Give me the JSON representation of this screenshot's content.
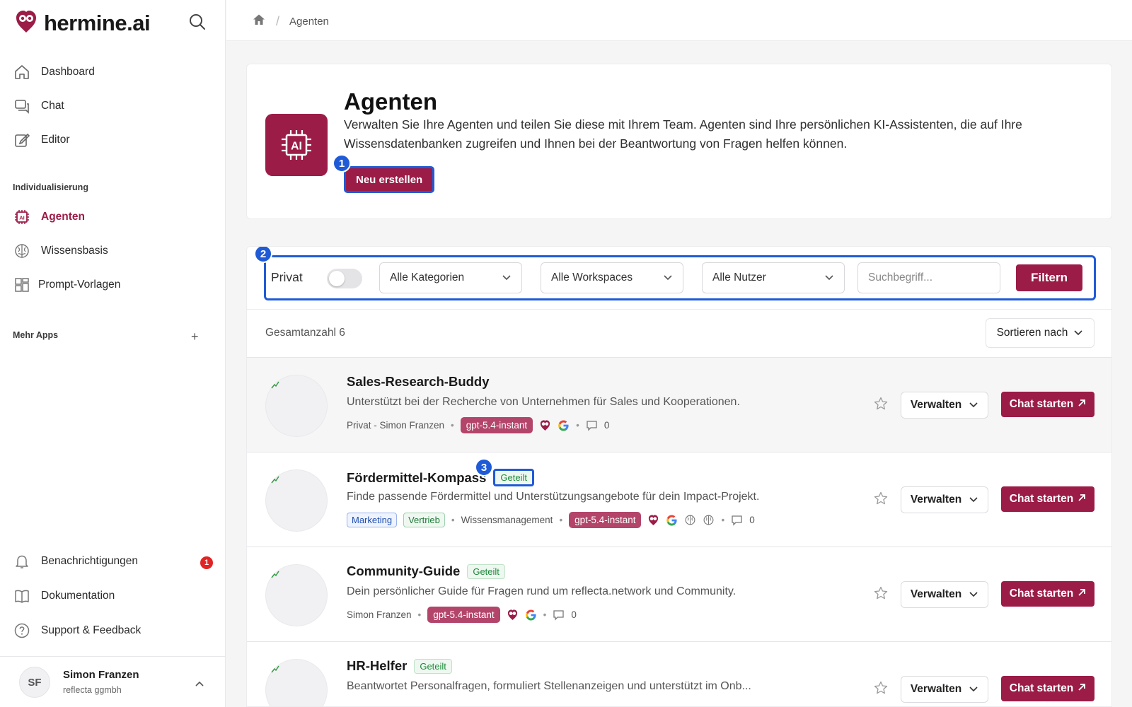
{
  "app": {
    "logo_text": "hermine.ai"
  },
  "sidebar": {
    "main_items": [
      {
        "label": "Dashboard",
        "icon": "home-icon"
      },
      {
        "label": "Chat",
        "icon": "chat-icon"
      },
      {
        "label": "Editor",
        "icon": "edit-icon"
      }
    ],
    "section_custom": "Individualisierung",
    "custom_items": [
      {
        "label": "Agenten",
        "icon": "ai-chip-icon",
        "active": true
      },
      {
        "label": "Wissensbasis",
        "icon": "brain-icon"
      },
      {
        "label": "Prompt-Vorlagen",
        "icon": "template-icon"
      }
    ],
    "section_more": "Mehr Apps",
    "bottom_items": [
      {
        "label": "Benachrichtigungen",
        "icon": "bell-icon",
        "badge": "1"
      },
      {
        "label": "Dokumentation",
        "icon": "book-icon"
      },
      {
        "label": "Support & Feedback",
        "icon": "help-icon"
      }
    ],
    "user": {
      "initials": "SF",
      "name": "Simon Franzen",
      "org": "reflecta ggmbh"
    }
  },
  "breadcrumb": {
    "current": "Agenten"
  },
  "hero": {
    "title": "Agenten",
    "description": "Verwalten Sie Ihre Agenten und teilen Sie diese mit Ihrem Team. Agenten sind Ihre persönlichen KI-Assistenten, die auf Ihre Wissensdatenbanken zugreifen und Ihnen bei der Beantwortung von Fragen helfen können.",
    "new_button": "Neu erstellen"
  },
  "markers": {
    "m1": "1",
    "m2": "2",
    "m3": "3"
  },
  "filters": {
    "privat_label": "Privat",
    "privat_on": false,
    "categories": "Alle Kategorien",
    "workspaces": "Alle Workspaces",
    "users": "Alle Nutzer",
    "search_placeholder": "Suchbegriff...",
    "filter_button": "Filtern"
  },
  "summary": {
    "total": "Gesamtanzahl 6",
    "sort_label": "Sortieren nach"
  },
  "agents": [
    {
      "name": "Sales-Research-Buddy",
      "shared": "",
      "description": "Unterstützt bei der Recherche von Unternehmen für Sales und Kooperationen.",
      "owner": "Privat - Simon Franzen",
      "model": "gpt-5.4-instant",
      "comments": "0",
      "manage": "Verwalten",
      "chat": "Chat starten"
    },
    {
      "name": "Fördermittel-Kompass",
      "shared": "Geteilt",
      "description": "Finde passende Fördermittel und Unterstützungsangebote für dein Impact-Projekt.",
      "tags": [
        "Marketing",
        "Vertrieb"
      ],
      "owner": "Wissensmanagement",
      "model": "gpt-5.4-instant",
      "comments": "0",
      "manage": "Verwalten",
      "chat": "Chat starten"
    },
    {
      "name": "Community-Guide",
      "shared": "Geteilt",
      "description": "Dein persönlicher Guide für Fragen rund um reflecta.network und Community.",
      "owner": "Simon Franzen",
      "model": "gpt-5.4-instant",
      "comments": "0",
      "manage": "Verwalten",
      "chat": "Chat starten"
    },
    {
      "name": "HR-Helfer",
      "shared": "Geteilt",
      "description": "Beantwortet Personalfragen, formuliert Stellenanzeigen und unterstützt im Onb...",
      "manage": "Verwalten",
      "chat": "Chat starten"
    }
  ],
  "colors": {
    "brand": "#9b1c47",
    "marker": "#1f5bd6",
    "shared_green": "#1f8a3c"
  }
}
